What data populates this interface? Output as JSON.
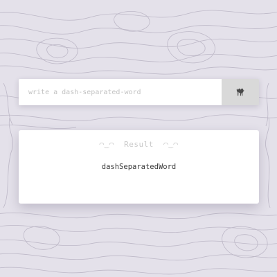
{
  "input": {
    "placeholder": "write a dash-separated-word",
    "value": ""
  },
  "convert_button": {
    "icon": "camel-icon"
  },
  "result": {
    "face_left": "◠‿◠",
    "label": "Result",
    "face_right": "◠‿◠",
    "value": "dashSeparatedWord"
  },
  "colors": {
    "background": "#e4e1ea",
    "contour_lines": "#bdb8c7",
    "card": "#ffffff",
    "button": "#d9d9d9",
    "icon": "#4a4a4a",
    "result_text": "#3a3a3a",
    "muted_text": "#c9c9c9"
  }
}
